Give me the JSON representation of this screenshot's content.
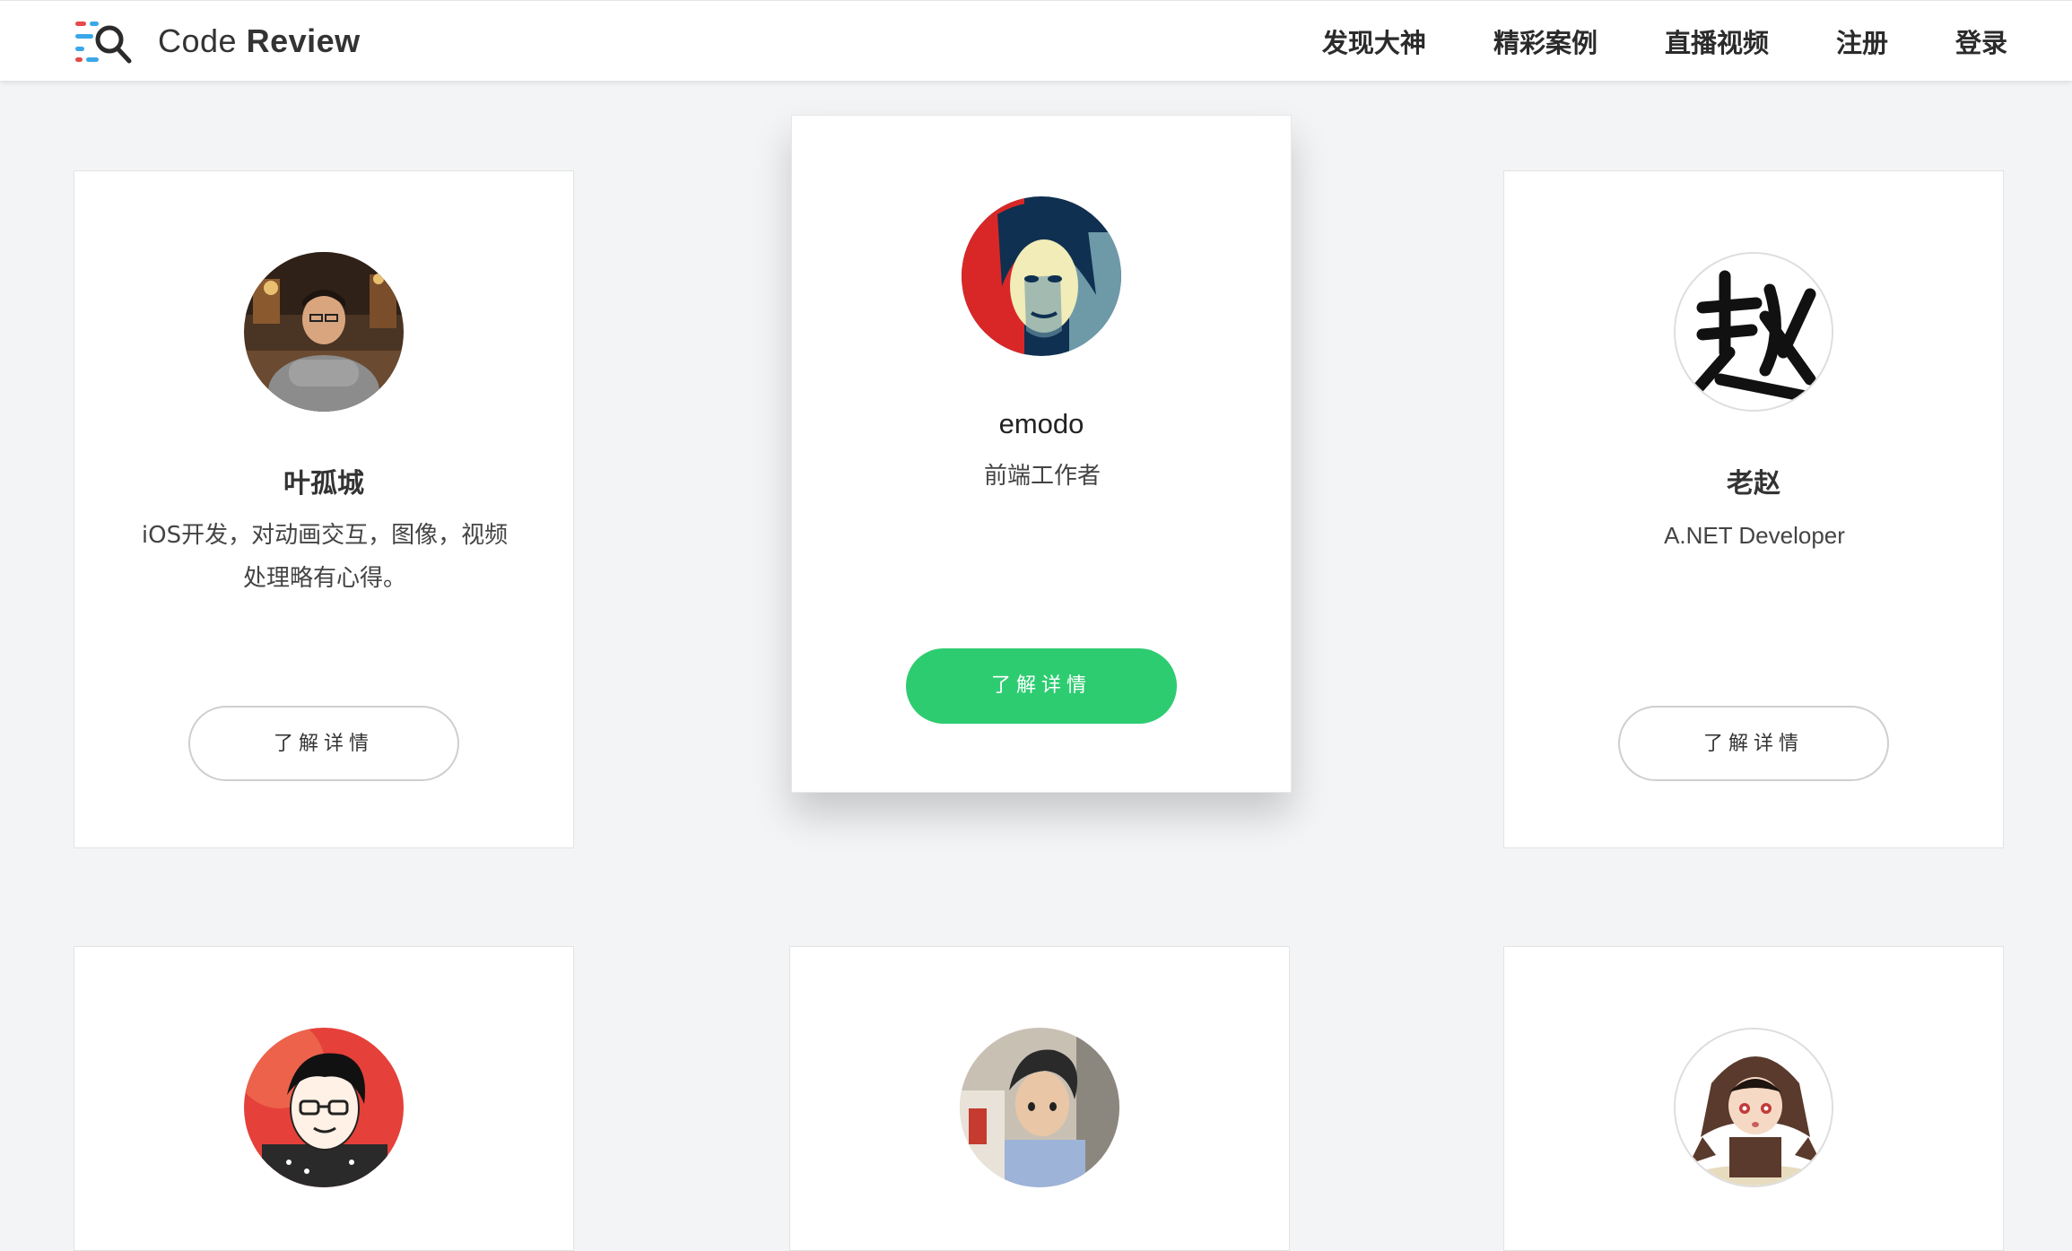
{
  "header": {
    "logo_prefix": "Code ",
    "logo_bold": "Review",
    "nav": [
      "发现大神",
      "精彩案例",
      "直播视频",
      "注册",
      "登录"
    ]
  },
  "cards": [
    {
      "name": "叶孤城",
      "desc": "iOS开发，对动画交互，图像，视频处理略有心得。",
      "button": "了解详情",
      "avatar": "photo-man-arms-crossed"
    },
    {
      "name": "emodo",
      "desc": "前端工作者",
      "button": "了解详情",
      "avatar": "poster-style-portrait"
    },
    {
      "name": "老赵",
      "desc": "A.NET Developer",
      "button": "了解详情",
      "avatar": "calligraphy-zhao"
    },
    {
      "avatar": "cartoon-man-glasses"
    },
    {
      "avatar": "3d-cartoon-boy"
    },
    {
      "avatar": "cartoon-girl-hood"
    }
  ],
  "colors": {
    "accent": "#2ecc71",
    "background": "#f3f4f6"
  }
}
